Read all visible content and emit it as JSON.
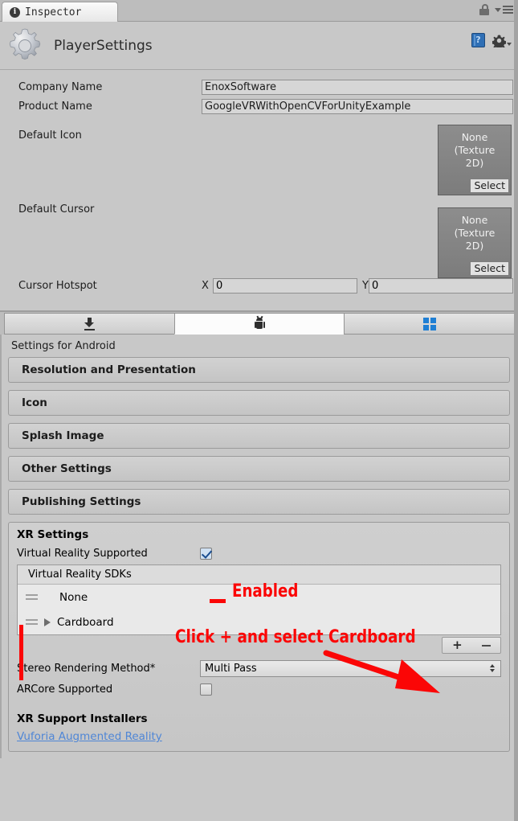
{
  "window": {
    "tab_label": "Inspector",
    "info_icon": "info-icon",
    "lock_icon": "lock-icon",
    "menu_icon": "hamburger-menu-icon"
  },
  "object_header": {
    "title": "PlayerSettings",
    "gear_icon": "gear-icon",
    "help_icon": "help-book-icon",
    "settings_icon": "cog-dropdown-icon"
  },
  "general": {
    "company_name_label": "Company Name",
    "company_name_value": "EnoxSoftware",
    "product_name_label": "Product Name",
    "product_name_value": "GoogleVRWithOpenCVForUnityExample",
    "default_icon_label": "Default Icon",
    "default_icon_value": "None\n(Texture 2D)",
    "default_icon_value_line1": "None",
    "default_icon_value_line2": "(Texture",
    "default_icon_value_line3": "2D)",
    "default_icon_select": "Select",
    "default_cursor_label": "Default Cursor",
    "default_cursor_value_line1": "None",
    "default_cursor_value_line2": "(Texture",
    "default_cursor_value_line3": "2D)",
    "default_cursor_select": "Select",
    "cursor_hotspot_label": "Cursor Hotspot",
    "cursor_hotspot_x_label": "X",
    "cursor_hotspot_x_value": "0",
    "cursor_hotspot_y_label": "Y",
    "cursor_hotspot_y_value": "0"
  },
  "platform_tabs": [
    {
      "name": "standalone",
      "icon": "download-icon",
      "active": false
    },
    {
      "name": "android",
      "icon": "android-robot-icon",
      "active": true
    },
    {
      "name": "windows-store",
      "icon": "windows-logo-icon",
      "active": false
    }
  ],
  "settings": {
    "heading": "Settings for Android",
    "sections": [
      "Resolution and Presentation",
      "Icon",
      "Splash Image",
      "Other Settings",
      "Publishing Settings"
    ]
  },
  "xr": {
    "title": "XR Settings",
    "vr_supported_label": "Virtual Reality Supported",
    "vr_supported_checked": true,
    "sdk_list_header": "Virtual Reality SDKs",
    "sdk_items": [
      {
        "name": "None",
        "foldable": false
      },
      {
        "name": "Cardboard",
        "foldable": true
      }
    ],
    "add_button_label": "+",
    "remove_button_label": "–",
    "stereo_label": "Stereo Rendering Method*",
    "stereo_value": "Multi Pass",
    "arcore_label": "ARCore Supported",
    "arcore_checked": false,
    "installers_title": "XR Support Installers",
    "installer_link": "Vuforia Augmented Reality"
  },
  "annotations": {
    "enabled_text": "Enabled",
    "click_text": "Click + and select Cardboard",
    "color": "#fb0606"
  }
}
